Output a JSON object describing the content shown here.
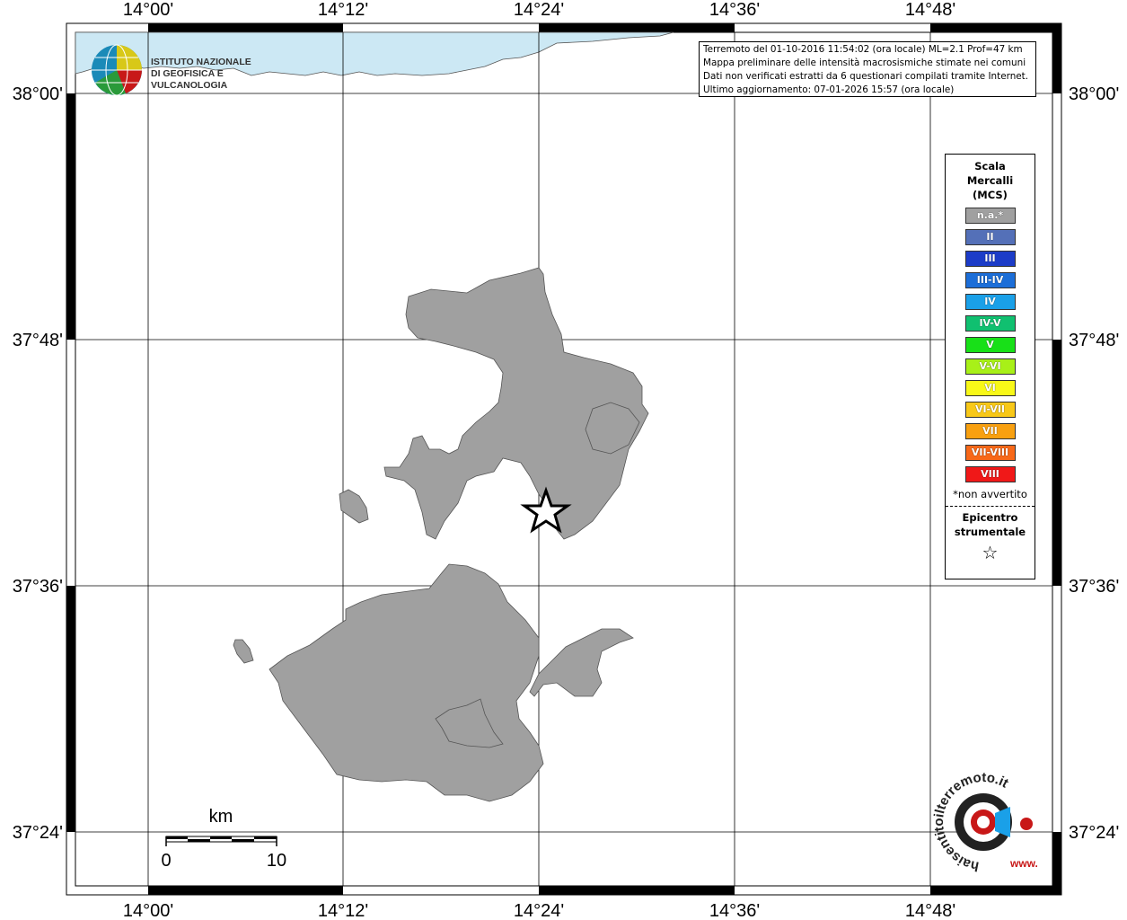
{
  "map": {
    "lon_labels": [
      "14°00'",
      "14°12'",
      "14°24'",
      "14°36'",
      "14°48'"
    ],
    "lat_labels": [
      "38°00'",
      "37°48'",
      "37°36'",
      "37°24'"
    ],
    "land_color": "#a0a0a0",
    "sea_color": "#cce8f4"
  },
  "info": {
    "line1": "Terremoto del 01-10-2016 11:54:02 (ora locale) ML=2.1 Prof=47 km",
    "line2": "Mappa preliminare delle intensità macrosismiche stimate nei comuni",
    "line3": "Dati non verificati estratti da 6 questionari compilati tramite Internet.",
    "line4": "Ultimo aggiornamento: 07-01-2026 15:57 (ora locale)"
  },
  "legend": {
    "title_line1": "Scala",
    "title_line2": "Mercalli",
    "title_line3": "(MCS)",
    "items": [
      {
        "label": "n.a.*",
        "color": "#a0a0a0"
      },
      {
        "label": "II",
        "color": "#5470b8"
      },
      {
        "label": "III",
        "color": "#1c3cc8"
      },
      {
        "label": "III-IV",
        "color": "#1c6ed8"
      },
      {
        "label": "IV",
        "color": "#1aa0e8"
      },
      {
        "label": "IV-V",
        "color": "#10c070"
      },
      {
        "label": "V",
        "color": "#18e018"
      },
      {
        "label": "V-VI",
        "color": "#a8f018"
      },
      {
        "label": "VI",
        "color": "#f8f818"
      },
      {
        "label": "VI-VII",
        "color": "#f8c818"
      },
      {
        "label": "VII",
        "color": "#f8a010"
      },
      {
        "label": "VII-VIII",
        "color": "#f86818"
      },
      {
        "label": "VIII",
        "color": "#f01818"
      }
    ],
    "note": "*non avvertito",
    "epi_line1": "Epicentro",
    "epi_line2": "strumentale",
    "epi_symbol": "☆"
  },
  "scale": {
    "title": "km",
    "start": "0",
    "end": "10"
  },
  "ingv_logo": {
    "line1": "ISTITUTO NAZIONALE",
    "line2": "DI GEOFISICA E VULCANOLOGIA"
  },
  "hai_logo": {
    "text": "haisentitoilterremoto.it",
    "www": "www."
  }
}
